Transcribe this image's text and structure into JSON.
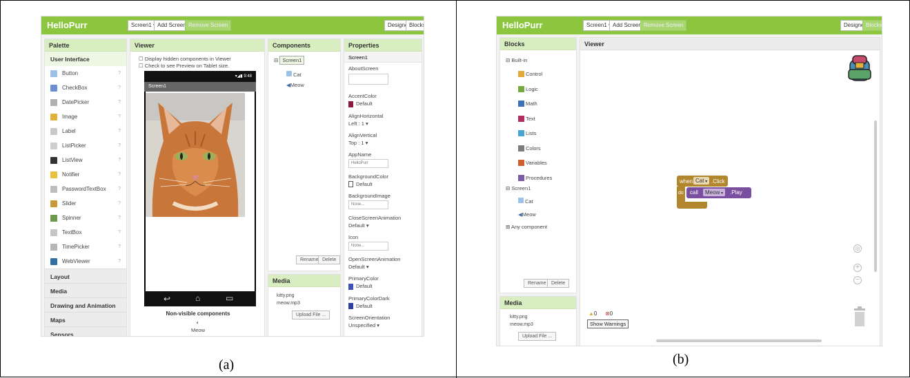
{
  "captions": {
    "a": "(a)",
    "b": "(b)"
  },
  "colors": {
    "accent": "#8cc63f",
    "panel_header": "#d9eec0",
    "event_block": "#b1862c",
    "procedure_block": "#7b4fa0"
  },
  "designer": {
    "brand": "HelloPurr",
    "toolbar": {
      "screen": "Screen1 ▾",
      "add_screen": "Add Screen ...",
      "remove_screen": "Remove Screen",
      "designer": "Designer",
      "blocks": "Blocks"
    },
    "palette": {
      "title": "Palette",
      "section": "User Interface",
      "items": [
        "Button",
        "CheckBox",
        "DatePicker",
        "Image",
        "Label",
        "ListPicker",
        "ListView",
        "Notifier",
        "PasswordTextBox",
        "Slider",
        "Spinner",
        "TextBox",
        "TimePicker",
        "WebViewer"
      ],
      "categories": [
        "Layout",
        "Media",
        "Drawing and Animation",
        "Maps",
        "Sensors"
      ]
    },
    "viewer": {
      "title": "Viewer",
      "option_hidden": "Display hidden components in Viewer",
      "option_tablet": "Check to see Preview on Tablet size.",
      "status_time": "9:48",
      "screen_title": "Screen1",
      "nonvisible_label": "Non-visible components",
      "nonvisible_item": "Meow"
    },
    "components": {
      "title": "Components",
      "tree": [
        "Screen1",
        "Cat",
        "Meow"
      ],
      "rename": "Rename",
      "delete": "Delete"
    },
    "media": {
      "title": "Media",
      "files": [
        "kitty.png",
        "meow.mp3"
      ],
      "upload": "Upload File ..."
    },
    "properties": {
      "title": "Properties",
      "screen": "Screen1",
      "about_screen": "AboutScreen",
      "accent_color": "AccentColor",
      "accent_value": "Default",
      "align_h": "AlignHorizontal",
      "align_h_value": "Left : 1 ▾",
      "align_v": "AlignVertical",
      "align_v_value": "Top : 1 ▾",
      "app_name": "AppName",
      "app_name_value": "HelloPurr",
      "bg_color": "BackgroundColor",
      "bg_color_value": "Default",
      "bg_image": "BackgroundImage",
      "bg_image_value": "None...",
      "close_anim": "CloseScreenAnimation",
      "close_anim_value": "Default ▾",
      "icon": "Icon",
      "icon_value": "None...",
      "open_anim": "OpenScreenAnimation",
      "open_anim_value": "Default ▾",
      "primary_color": "PrimaryColor",
      "primary_color_value": "Default",
      "primary_dark": "PrimaryColorDark",
      "primary_dark_value": "Default",
      "orientation": "ScreenOrientation",
      "orientation_value": "Unspecified ▾"
    }
  },
  "blocks_editor": {
    "brand": "HelloPurr",
    "toolbar": {
      "screen": "Screen1 ▾",
      "add_screen": "Add Screen ...",
      "remove_screen": "Remove Screen",
      "designer": "Designer",
      "blocks": "Blocks"
    },
    "blocks_panel": {
      "title": "Blocks",
      "builtin": "Built-in",
      "builtin_items": [
        {
          "label": "Control",
          "color": "#e1a83a"
        },
        {
          "label": "Logic",
          "color": "#77ab41"
        },
        {
          "label": "Math",
          "color": "#3f71b5"
        },
        {
          "label": "Text",
          "color": "#b32d5e"
        },
        {
          "label": "Lists",
          "color": "#49a6d4"
        },
        {
          "label": "Colors",
          "color": "#7d7d7d"
        },
        {
          "label": "Variables",
          "color": "#d05f2d"
        },
        {
          "label": "Procedures",
          "color": "#7c5ba6"
        }
      ],
      "screen": "Screen1",
      "screen_items": [
        "Cat",
        "Meow"
      ],
      "any": "Any component",
      "rename": "Rename",
      "delete": "Delete"
    },
    "media": {
      "title": "Media",
      "files": [
        "kitty.png",
        "meow.mp3"
      ],
      "upload": "Upload File ..."
    },
    "viewer": {
      "title": "Viewer",
      "block_when": "when",
      "block_component": "Cat",
      "block_event": ".Click",
      "block_do": "do",
      "block_call": "call",
      "block_target": "Meow",
      "block_method": ".Play",
      "warnings_count": "0",
      "errors_count": "0",
      "show_warnings": "Show Warnings"
    }
  }
}
